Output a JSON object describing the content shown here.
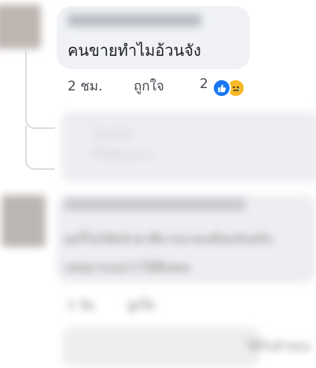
{
  "comment": {
    "text": "คนขายทำไมอ้วนจัง",
    "time": "2 ชม.",
    "like_label": "ถูกใจ",
    "reaction_count": "2"
  },
  "reply": {
    "text_line1": "ไม่สนใจ",
    "text_line2": "ก็ไม่ต้องอ่าน"
  },
  "second_comment": {
    "text_line1": "ผมก็ไม่ได้หน้าตาดีมากมายเหมือนกันครับ",
    "text_line2": "แค่อยากบอกว่าได้ดีเสมอ",
    "time": "1 วัน",
    "like_label": "ถูกใจ",
    "reply_preview": "ได้รับคำตอบ"
  },
  "colors": {
    "like_blue": "#1877f2",
    "bubble_bg": "#f0f2f5",
    "sad_yellow": "#f7b928"
  },
  "icons": {
    "like": "like-thumb-icon",
    "sad": "sad-face-icon"
  }
}
